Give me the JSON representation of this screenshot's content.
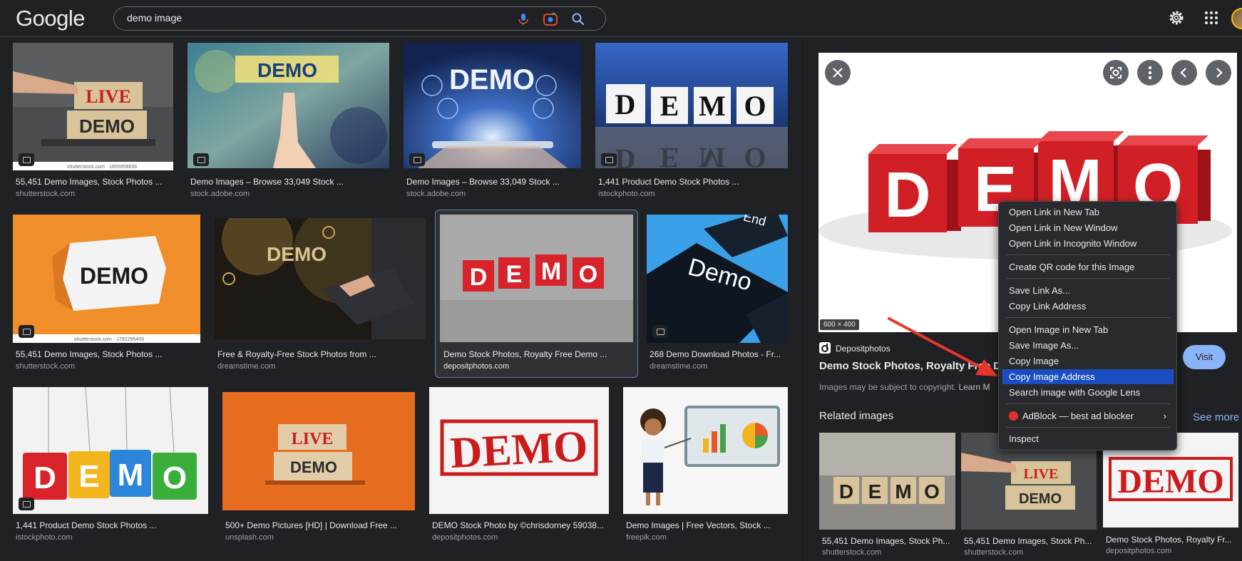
{
  "header": {
    "logo": "Google",
    "search_value": "demo image"
  },
  "results": [
    {
      "caption": "55,451 Demo Images, Stock Photos ...",
      "source": "shutterstock.com"
    },
    {
      "caption": "Demo Images – Browse 33,049 Stock ...",
      "source": "stock.adobe.com"
    },
    {
      "caption": "Demo Images – Browse 33,049 Stock ...",
      "source": "stock.adobe.com"
    },
    {
      "caption": "1,441 Product Demo Stock Photos ...",
      "source": "istockphoto.com"
    },
    {
      "caption": "55,451 Demo Images, Stock Photos ...",
      "source": "shutterstock.com"
    },
    {
      "caption": "Free & Royalty-Free Stock Photos from ...",
      "source": "dreamstime.com"
    },
    {
      "caption": "Demo Stock Photos, Royalty Free Demo ...",
      "source": "depositphotos.com"
    },
    {
      "caption": "268 Demo Download Photos - Fr...",
      "source": "dreamstime.com"
    },
    {
      "caption": "1,441 Product Demo Stock Photos ...",
      "source": "istockphoto.com"
    },
    {
      "caption": "500+ Demo Pictures [HD] | Download Free ...",
      "source": "unsplash.com"
    },
    {
      "caption": "DEMO Stock Photo by ©chrisdorney 59038...",
      "source": "depositphotos.com"
    },
    {
      "caption": "Demo Images | Free Vectors, Stock ...",
      "source": "freepik.com"
    }
  ],
  "thumb_text": {
    "live": "LIVE",
    "demo_upper": "DEMO",
    "demo_title": "Demo",
    "end": "End",
    "wm_shutter_1": "shutterstock.com · 1855958839",
    "wm_shutter_2": "shutterstock.com · 1782295403"
  },
  "panel": {
    "dims": "600 × 400",
    "site": "Depositphotos",
    "title": "Demo Stock Photos, Royalty Free D",
    "copyright": "Images may be subject to copyright.",
    "learn_more": "Learn M",
    "visit": "Visit",
    "related_title": "Related images",
    "see_more": "See more",
    "preview_word": "DEMO",
    "related": [
      {
        "caption": "55,451 Demo Images, Stock Ph...",
        "source": "shutterstock.com"
      },
      {
        "caption": "55,451 Demo Images, Stock Ph...",
        "source": "shutterstock.com"
      },
      {
        "caption": "Demo Stock Photos, Royalty Fr...",
        "source": "depositphotos.com"
      }
    ]
  },
  "context_menu": {
    "items": [
      "Open Link in New Tab",
      "Open Link in New Window",
      "Open Link in Incognito Window",
      "Create QR code for this Image",
      "Save Link As...",
      "Copy Link Address",
      "Open Image in New Tab",
      "Save Image As...",
      "Copy Image",
      "Copy Image Address",
      "Search image with Google Lens",
      "AdBlock — best ad blocker",
      "Inspect"
    ],
    "highlighted_index": 9
  },
  "colors": {
    "background": "#202124",
    "menu_highlight": "#1a4ec0",
    "link": "#8ab4f8",
    "arrow": "#e8372a"
  }
}
